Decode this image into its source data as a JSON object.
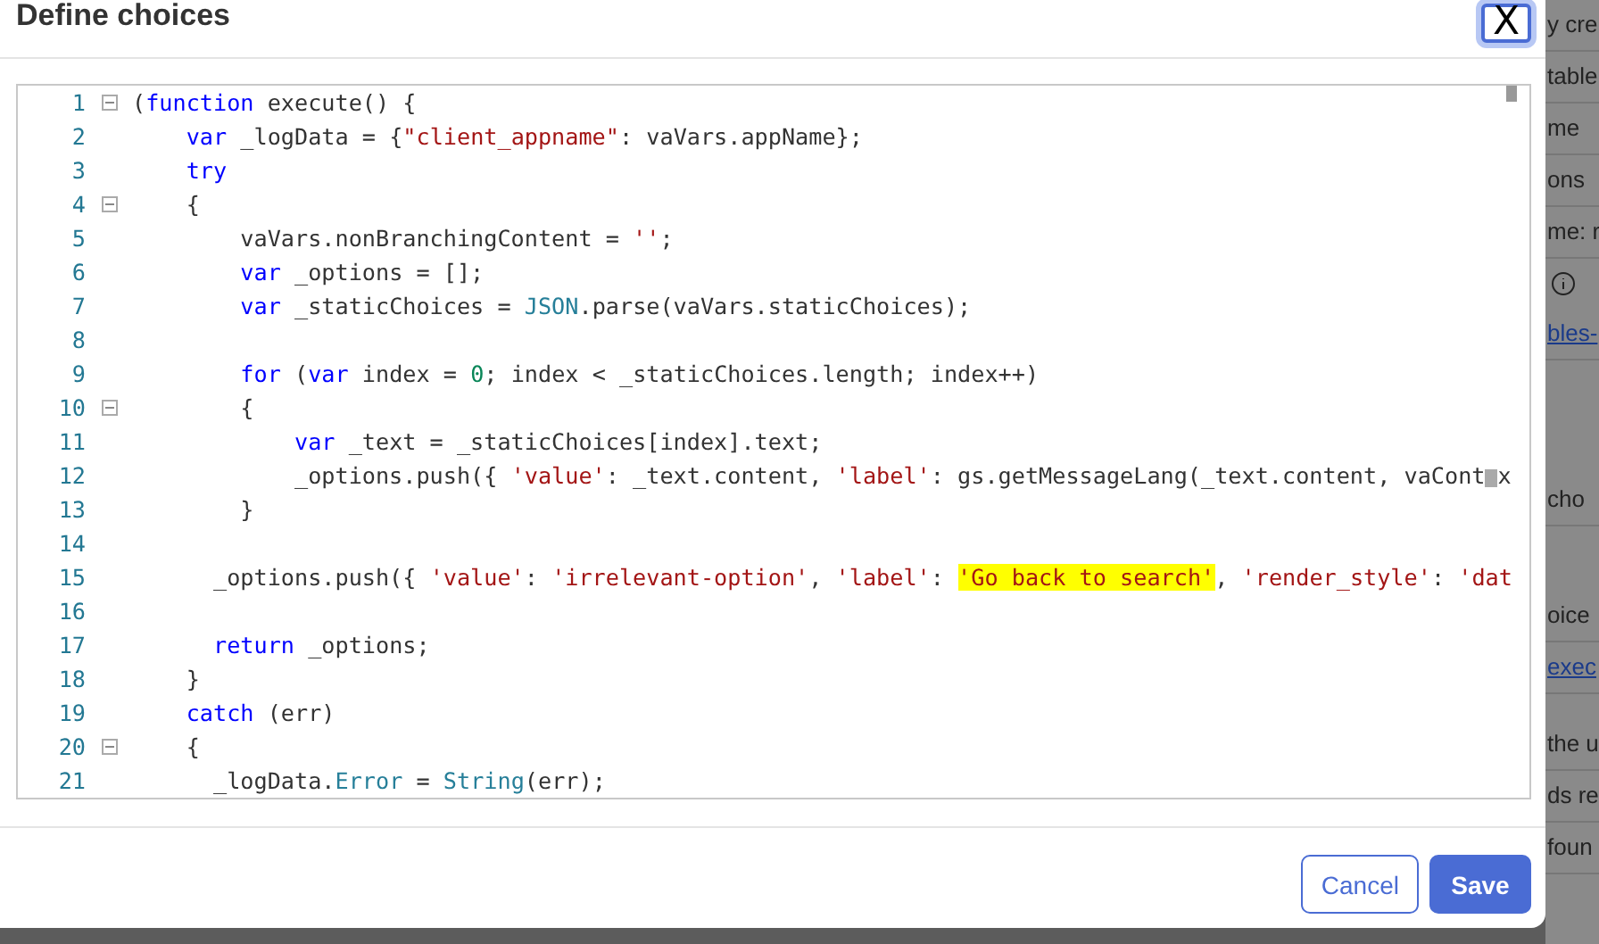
{
  "dialog": {
    "title": "Define choices",
    "close_label": "X"
  },
  "editor": {
    "lines": [
      {
        "number": "1",
        "foldable": true,
        "tokens": [
          {
            "kind": "plain",
            "text": "("
          },
          {
            "kind": "kw",
            "text": "function"
          },
          {
            "kind": "plain",
            "text": " execute() {"
          }
        ]
      },
      {
        "number": "2",
        "foldable": false,
        "tokens": [
          {
            "kind": "kw",
            "text": "    var"
          },
          {
            "kind": "plain",
            "text": " _logData = {"
          },
          {
            "kind": "str",
            "text": "\"client_appname\""
          },
          {
            "kind": "plain",
            "text": ": vaVars.appName};"
          }
        ]
      },
      {
        "number": "3",
        "foldable": false,
        "tokens": [
          {
            "kind": "kw",
            "text": "    try"
          }
        ]
      },
      {
        "number": "4",
        "foldable": true,
        "tokens": [
          {
            "kind": "plain",
            "text": "    {"
          }
        ]
      },
      {
        "number": "5",
        "foldable": false,
        "tokens": [
          {
            "kind": "plain",
            "text": "        vaVars.nonBranchingContent = "
          },
          {
            "kind": "str",
            "text": "''"
          },
          {
            "kind": "plain",
            "text": ";"
          }
        ]
      },
      {
        "number": "6",
        "foldable": false,
        "tokens": [
          {
            "kind": "kw",
            "text": "        var"
          },
          {
            "kind": "plain",
            "text": " _options = [];"
          }
        ]
      },
      {
        "number": "7",
        "foldable": false,
        "tokens": [
          {
            "kind": "kw",
            "text": "        var"
          },
          {
            "kind": "plain",
            "text": " _staticChoices = "
          },
          {
            "kind": "type",
            "text": "JSON"
          },
          {
            "kind": "plain",
            "text": ".parse(vaVars.staticChoices);"
          }
        ]
      },
      {
        "number": "8",
        "foldable": false
      },
      {
        "number": "9",
        "foldable": false,
        "tokens": [
          {
            "kind": "kw",
            "text": "        for"
          },
          {
            "kind": "plain",
            "text": " ("
          },
          {
            "kind": "kw",
            "text": "var"
          },
          {
            "kind": "plain",
            "text": " index = "
          },
          {
            "kind": "num",
            "text": "0"
          },
          {
            "kind": "plain",
            "text": "; index < _staticChoices.length; index++)"
          }
        ]
      },
      {
        "number": "10",
        "foldable": true,
        "tokens": [
          {
            "kind": "plain",
            "text": "        {"
          }
        ]
      },
      {
        "number": "11",
        "foldable": false,
        "tokens": [
          {
            "kind": "kw",
            "text": "            var"
          },
          {
            "kind": "plain",
            "text": " _text = _staticChoices[index].text;"
          }
        ]
      },
      {
        "number": "12",
        "foldable": false,
        "tokens": [
          {
            "kind": "plain",
            "text": "            _options.push({ "
          },
          {
            "kind": "str",
            "text": "'value'"
          },
          {
            "kind": "plain",
            "text": ": _text.content, "
          },
          {
            "kind": "str",
            "text": "'label'"
          },
          {
            "kind": "plain",
            "text": ": gs.getMessageLang(_text.content, vaCont"
          },
          {
            "kind": "gap"
          },
          {
            "kind": "plain",
            "text": "x"
          }
        ]
      },
      {
        "number": "13",
        "foldable": false,
        "tokens": [
          {
            "kind": "plain",
            "text": "        }"
          }
        ]
      },
      {
        "number": "14",
        "foldable": false
      },
      {
        "number": "15",
        "foldable": false,
        "tokens": [
          {
            "kind": "plain",
            "text": "      _options.push({ "
          },
          {
            "kind": "str",
            "text": "'value'"
          },
          {
            "kind": "plain",
            "text": ": "
          },
          {
            "kind": "str",
            "text": "'irrelevant-option'"
          },
          {
            "kind": "plain",
            "text": ", "
          },
          {
            "kind": "str",
            "text": "'label'"
          },
          {
            "kind": "plain",
            "text": ": "
          },
          {
            "kind": "mark",
            "text": "'Go back to search'"
          },
          {
            "kind": "plain",
            "text": ", "
          },
          {
            "kind": "str",
            "text": "'render_style'"
          },
          {
            "kind": "plain",
            "text": ": "
          },
          {
            "kind": "str",
            "text": "'dat"
          }
        ]
      },
      {
        "number": "16",
        "foldable": false
      },
      {
        "number": "17",
        "foldable": false,
        "tokens": [
          {
            "kind": "kw",
            "text": "      return"
          },
          {
            "kind": "plain",
            "text": " _options;"
          }
        ]
      },
      {
        "number": "18",
        "foldable": false,
        "tokens": [
          {
            "kind": "plain",
            "text": "    }"
          }
        ]
      },
      {
        "number": "19",
        "foldable": false,
        "tokens": [
          {
            "kind": "kw",
            "text": "    catch"
          },
          {
            "kind": "plain",
            "text": " (err)"
          }
        ]
      },
      {
        "number": "20",
        "foldable": true,
        "tokens": [
          {
            "kind": "plain",
            "text": "    {"
          }
        ]
      },
      {
        "number": "21",
        "foldable": false,
        "tokens": [
          {
            "kind": "plain",
            "text": "      _logData."
          },
          {
            "kind": "type",
            "text": "Error"
          },
          {
            "kind": "plain",
            "text": " = "
          },
          {
            "kind": "type",
            "text": "String"
          },
          {
            "kind": "plain",
            "text": "(err);"
          }
        ]
      }
    ]
  },
  "buttons": [
    {
      "label": "Cancel",
      "kind": "secondary"
    },
    {
      "label": "Save",
      "kind": "primary"
    }
  ],
  "background_page": [
    {
      "kind": "text",
      "text": "y cre"
    },
    {
      "kind": "text",
      "text": "table"
    },
    {
      "kind": "text",
      "text": "me"
    },
    {
      "kind": "text",
      "text": "ons"
    },
    {
      "kind": "text",
      "text": "me: r"
    },
    {
      "kind": "info"
    },
    {
      "kind": "link",
      "text": "bles-"
    },
    {
      "kind": "text",
      "text": "cho"
    },
    {
      "kind": "text",
      "text": "oice"
    },
    {
      "kind": "link",
      "text": "exec"
    },
    {
      "kind": "text",
      "text": "the u"
    },
    {
      "kind": "text",
      "text": "ds re"
    },
    {
      "kind": "text",
      "text": "foun"
    }
  ]
}
